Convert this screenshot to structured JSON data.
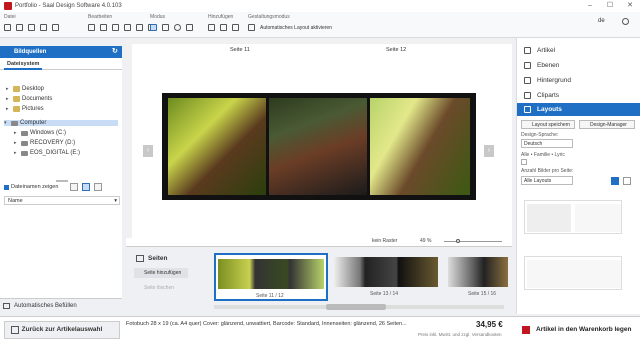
{
  "window": {
    "title": "Portfolio - Saal Design Software 4.0.103"
  },
  "toolbar": {
    "groups": [
      {
        "label": "Datei"
      },
      {
        "label": "Bearbeiten"
      },
      {
        "label": "Modus"
      },
      {
        "label": "Hinzufügen"
      },
      {
        "label": "Gestaltungsmodus"
      }
    ],
    "auto_layout": "Automatisches Layout aktivieren",
    "lang": "de"
  },
  "left": {
    "header": "Bildquellen",
    "tab": "Dateisystem",
    "tree": [
      "Desktop",
      "Documents",
      "Pictures",
      "Computer",
      "Windows (C:)",
      "RECOVERY (D:)",
      "EOS_DIGITAL (E:)"
    ],
    "show_names": "Dateinamen zeigen",
    "name_sort": "Name",
    "auto_fill": "Automatisches Befüllen"
  },
  "canvas": {
    "page_left": "Seite 11",
    "page_right": "Seite 12",
    "raster": "kein Raster",
    "zoom": "49 %"
  },
  "pages": {
    "title": "Seiten",
    "add": "Seite hinzufügen",
    "delete": "Seite löschen",
    "thumbs": [
      "Seite 11 / 12",
      "Seite 13 / 14",
      "Seite 15 / 16"
    ]
  },
  "right": {
    "items": [
      "Artikel",
      "Ebenen",
      "Hintergrund",
      "Cliparts",
      "Layouts"
    ],
    "save_layout": "Layout speichern",
    "design_manager": "Design-Manager",
    "design_lang_label": "Design-Sprache:",
    "design_lang": "Deutsch",
    "filter": "Alle • Familie • Lyric",
    "count_label": "Anzahl Bilder pro Seite:",
    "count": "Alle Layouts"
  },
  "bottom": {
    "back": "Zurück zur Artikelauswahl",
    "product": "Fotobuch 28 x 19 (ca. A4 quer) Cover: glänzend, unwattiert, Barcode: Standard, Innenseiten: glänzend, 26 Seiten...",
    "price": "34,95 €",
    "price_note": "Preis inkl. MwSt. und zzgl. Versandkosten",
    "cart": "Artikel in den Warenkorb legen"
  },
  "colors": {
    "accent": "#1f6fc4",
    "brand": "#c0161d"
  }
}
